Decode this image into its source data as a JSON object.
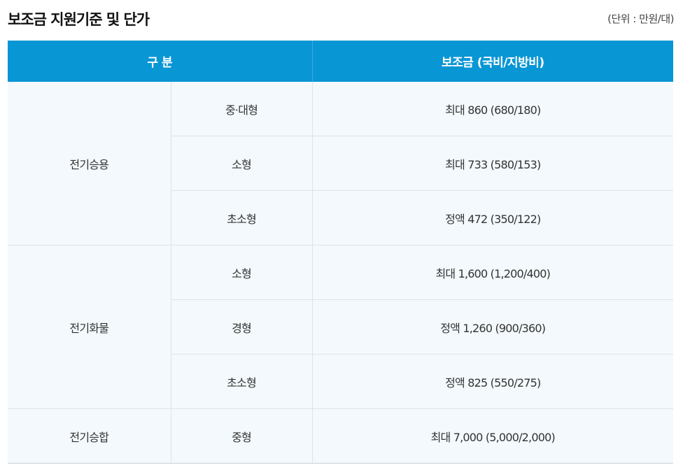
{
  "title": "보조금 지원기준 및 단가",
  "unit_note": "(단위 : 만원/대)",
  "table": {
    "headers": {
      "category": "구 분",
      "subsidy": "보조금 (국비/지방비)"
    },
    "groups": [
      {
        "category": "전기승용",
        "rows": [
          {
            "size": "중·대형",
            "subsidy": "최대 860 (680/180)"
          },
          {
            "size": "소형",
            "subsidy": "최대 733 (580/153)"
          },
          {
            "size": "초소형",
            "subsidy": "정액 472 (350/122)"
          }
        ]
      },
      {
        "category": "전기화물",
        "rows": [
          {
            "size": "소형",
            "subsidy": "최대 1,600 (1,200/400)"
          },
          {
            "size": "경형",
            "subsidy": "정액 1,260 (900/360)"
          },
          {
            "size": "초소형",
            "subsidy": "정액 825 (550/275)"
          }
        ]
      },
      {
        "category": "전기승합",
        "rows": [
          {
            "size": "중형",
            "subsidy": "최대 7,000 (5,000/2,000)"
          }
        ]
      }
    ]
  },
  "colors": {
    "header_bg": "#0996d5",
    "cell_bg": "#f3f9fc"
  }
}
